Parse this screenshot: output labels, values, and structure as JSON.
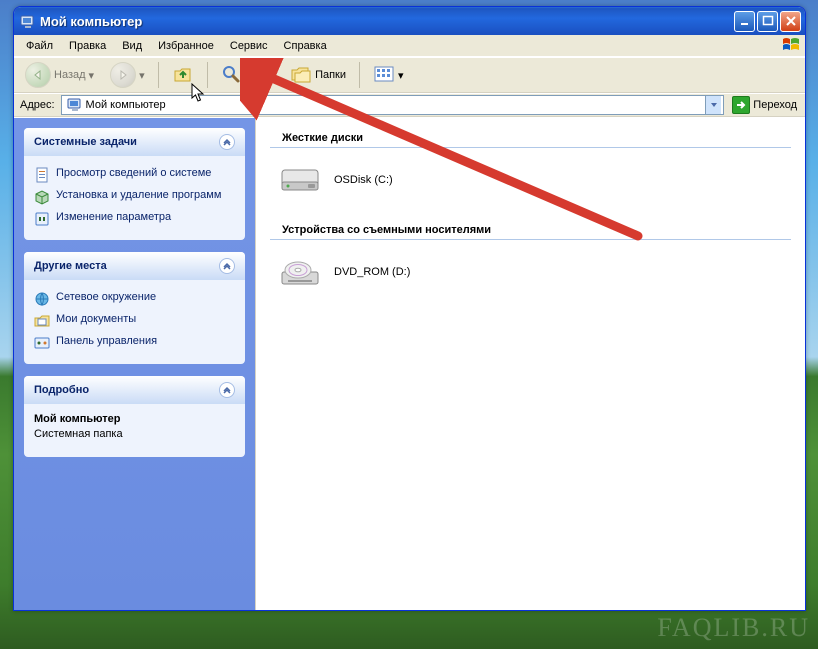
{
  "title": "Мой компьютер",
  "menus": [
    "Файл",
    "Правка",
    "Вид",
    "Избранное",
    "Сервис",
    "Справка"
  ],
  "toolbar": {
    "back": "Назад",
    "search": "Поиск",
    "folders": "Папки"
  },
  "address": {
    "label": "Адрес:",
    "value": "Мой компьютер",
    "go": "Переход"
  },
  "sidebar": {
    "tasks": {
      "title": "Системные задачи",
      "items": [
        "Просмотр сведений о системе",
        "Установка и удаление программ",
        "Изменение параметра"
      ]
    },
    "places": {
      "title": "Другие места",
      "items": [
        "Сетевое окружение",
        "Мои документы",
        "Панель управления"
      ]
    },
    "details": {
      "title": "Подробно",
      "name": "Мой компьютер",
      "type": "Системная папка"
    }
  },
  "content": {
    "groups": [
      {
        "title": "Жесткие диски",
        "items": [
          {
            "label": "OSDisk (C:)",
            "icon": "hdd"
          }
        ]
      },
      {
        "title": "Устройства со съемными носителями",
        "items": [
          {
            "label": "DVD_ROM (D:)",
            "icon": "dvd"
          }
        ]
      }
    ]
  },
  "watermark": "FAQLIB.RU"
}
